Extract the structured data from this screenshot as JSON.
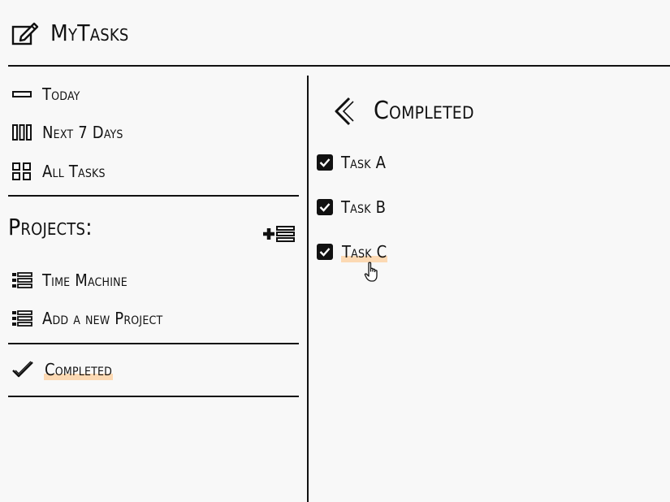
{
  "app": {
    "title": "MyTasks"
  },
  "nav": {
    "items": [
      {
        "label": "Today",
        "icon": "today-icon"
      },
      {
        "label": "Next 7 Days",
        "icon": "week-icon"
      },
      {
        "label": "All Tasks",
        "icon": "grid-icon"
      }
    ]
  },
  "projects": {
    "title": "Projects:",
    "add_icon": "add-list-icon",
    "items": [
      {
        "label": "Time Machine",
        "icon": "list-icon"
      },
      {
        "label": "Add a new Project",
        "icon": "list-icon"
      }
    ]
  },
  "completed_nav": {
    "label": "Completed",
    "icon": "checkmark-icon"
  },
  "main": {
    "title": "Completed",
    "back_icon": "chevron-left-icon",
    "tasks": [
      {
        "label": "Task A",
        "checked": true
      },
      {
        "label": "Task B",
        "checked": true
      },
      {
        "label": "Task C",
        "checked": true
      }
    ]
  },
  "colors": {
    "highlight": "#fcd9b3",
    "ink": "#111111",
    "background": "#f8f8f8"
  }
}
